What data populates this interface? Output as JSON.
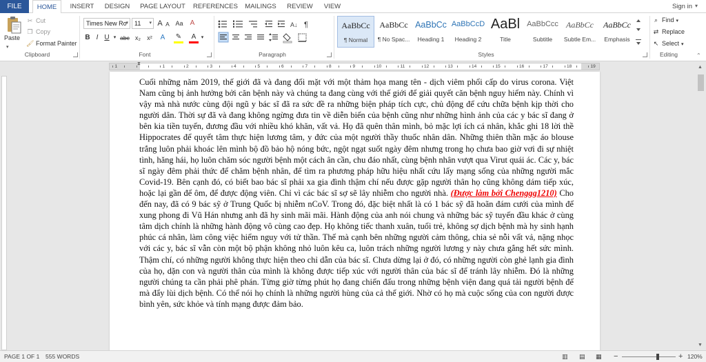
{
  "tabs": {
    "file": "FILE",
    "items": [
      "HOME",
      "INSERT",
      "DESIGN",
      "PAGE LAYOUT",
      "REFERENCES",
      "MAILINGS",
      "REVIEW",
      "VIEW"
    ],
    "active": "HOME",
    "signin": "Sign in"
  },
  "clipboard": {
    "paste": "Paste",
    "cut": "Cut",
    "copy": "Copy",
    "format_painter": "Format Painter",
    "label": "Clipboard"
  },
  "font": {
    "name": "Times New Ro",
    "size": "11",
    "label": "Font",
    "bold": "B",
    "italic": "I",
    "underline": "U",
    "strikethrough": "abc",
    "subscript": "x₂",
    "superscript": "x²",
    "grow": "A",
    "shrink": "A",
    "case": "Aa",
    "clear": "A",
    "color_letter": "A",
    "highlight_letter": "A"
  },
  "paragraph": {
    "label": "Paragraph",
    "sort": "A↓",
    "show_marks": "¶"
  },
  "styles": {
    "label": "Styles",
    "items": [
      {
        "preview": "AaBbCc",
        "name": "¶ Normal"
      },
      {
        "preview": "AaBbCc",
        "name": "¶ No Spac..."
      },
      {
        "preview": "AaBbCc",
        "name": "Heading 1"
      },
      {
        "preview": "AaBbCcD",
        "name": "Heading 2"
      },
      {
        "preview": "AaBl",
        "name": "Title"
      },
      {
        "preview": "AaBbCcc",
        "name": "Subtitle"
      },
      {
        "preview": "AaBbCc",
        "name": "Subtle Em..."
      },
      {
        "preview": "AaBbCc",
        "name": "Emphasis"
      }
    ],
    "selected_index": 0
  },
  "editing": {
    "label": "Editing",
    "find": "Find",
    "replace": "Replace",
    "select": "Select"
  },
  "ruler": {
    "numbers": [
      "1",
      "2",
      "1",
      "2",
      "3",
      "4",
      "5",
      "6",
      "7",
      "8",
      "9",
      "10",
      "11",
      "12",
      "13",
      "14",
      "15",
      "16",
      "17",
      "18",
      "19"
    ]
  },
  "document": {
    "text_before": "Cuối những năm 2019, thế giới đã và đang đối mặt với một thảm họa mang tên - dịch viêm phổi cấp do virus corona. Việt Nam cũng bị ảnh hưởng bởi căn bệnh này và chúng ta đang cùng với thế giới để giải quyết căn bệnh nguy hiểm này. Chính vì vậy mà nhà nước cùng đội ngũ y bác sĩ đã ra sức đề ra những biện pháp tích cực, chủ động để cứu chữa bệnh kịp thời cho người dân. Thời sự đã và đang không ngừng đưa tin về diễn biến của bệnh cũng như những hình ảnh của các y bác sĩ đang ở bên kia tiền tuyến, đương đầu với nhiều khó khăn, vất vả. Họ đã quên thân mình, bỏ mặc lợi ích cá nhân, khắc ghi 18 lời thề Hippocrates để quyết tâm thực hiện lương tâm, y đức của một người thầy thuốc nhân dân. Những thiên thần mặc áo blouse trắng luôn phải khoác lên mình bộ đồ bảo hộ nóng bức, ngột ngạt suốt ngày đêm nhưng trong họ chưa bao giờ vơi đi sự nhiệt tình, hăng hái, họ luôn chăm sóc người bệnh một cách ân cần, chu đáo nhất, cùng bệnh nhân vượt qua Virut quái ác. Các y, bác sĩ ngày đêm phải thức để chăm bệnh nhân, để tìm ra phương pháp hữu hiệu nhất cứu lấy mạng sống của những người mắc Covid-19. Bên cạnh đó, có biết bao bác sĩ phải xa gia đình thậm chí nếu được gặp người thân họ cũng không dám tiếp xúc, hoặc lại gần để ôm, để được động viên. Chỉ vì các bác sĩ sợ sẽ lây nhiễm cho người nhà. ",
    "link": "(Được làm bởi Chenggg1210)",
    "text_after": " Cho đến nay, đã có 9 bác sỹ ở Trung Quốc bị nhiễm nCoV. Trong đó, đặc biệt nhất là có 1 bác sỹ đã hoãn đám cưới của mình để xung phong đi Vũ Hán nhưng anh đã hy sinh mãi mãi. Hành động của anh nói chung và những bác sỹ tuyến đầu khác ở cùng tâm dịch chính là những hành động vô cùng cao đẹp. Họ không tiếc thanh xuân, tuổi trẻ, không sợ dịch bệnh mà hy sinh hạnh phúc cá nhân, làm công việc hiểm nguy với tử thần. Thế mà cạnh bên những người cảm thông, chia sẻ nỗi vất vả, nặng nhọc với các y, bác sĩ vẫn còn một bộ phận không nhỏ luôn kêu ca, luôn trách những người lương y này chưa gắng hết sức mình. Thậm chí, có những người không thực hiện theo chỉ dẫn của bác sĩ. Chưa dừng lại ở đó, có những người còn ghẻ lạnh gia đình của họ, dặn con và người thân của mình là không được tiếp xúc với người thân của bác sĩ để tránh lây nhiễm. Đó là những người chúng ta cần phải phê phán. Từng giờ từng phút họ đang chiến đấu trong những bệnh viện đang quá tải người bệnh để mà đẩy lùi dịch bệnh. Có thể nói họ chính là những người hùng của cả thế giới. Nhờ có họ mà cuộc sống của con người được bình yên, sức khỏe và tính mạng được đảm bảo."
  },
  "status": {
    "page": "PAGE 1 OF 1",
    "words": "555 WORDS",
    "zoom_minus": "−",
    "zoom_plus": "+",
    "zoom": "120%"
  }
}
